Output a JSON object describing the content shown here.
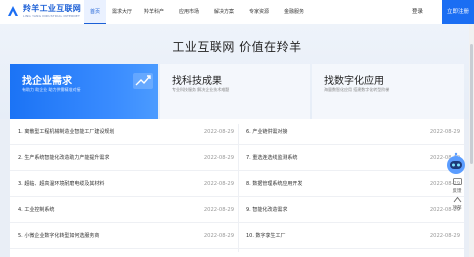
{
  "logo": {
    "title": "羚羊工业互联网",
    "subtitle": "LING YANG INDUSTRIAL INTERNET",
    "icon": "antelope-logo-icon"
  },
  "nav": {
    "items": [
      {
        "label": "首页",
        "active": true
      },
      {
        "label": "需求大厅",
        "active": false
      },
      {
        "label": "羚羊科产",
        "active": false
      },
      {
        "label": "应用市场",
        "active": false
      },
      {
        "label": "解决方案",
        "active": false
      },
      {
        "label": "专家资源",
        "active": false
      },
      {
        "label": "金融服务",
        "active": false
      }
    ],
    "login": "登录",
    "register": "立即注册"
  },
  "hero": {
    "title": "工业互联网 价值在羚羊",
    "cards": [
      {
        "title": "找企业需求",
        "subtitle": "有助力 助企业 助力供需精准对接",
        "icon": "growth-chart-icon"
      },
      {
        "title": "找科技成果",
        "subtitle": "专业科技服务 解决企业技术难题",
        "icon": "lightbulb-icon"
      },
      {
        "title": "找数字化应用",
        "subtitle": "海量数智化应用 搭建数字化转型阶梯",
        "icon": "app-grid-icon"
      }
    ]
  },
  "list": {
    "left": [
      {
        "title": "1. 离散型工程机械制造业智能工厂建设规划",
        "date": "2022-08-29"
      },
      {
        "title": "2. 生产系统智能化改造助力产能提升需求",
        "date": "2022-08-29"
      },
      {
        "title": "3. 超临、超高温环境耐磨电缆及其材料",
        "date": "2022-08-29"
      },
      {
        "title": "4. 工业控制系统",
        "date": "2022-08-29"
      },
      {
        "title": "5. 小微企业数字化转型如何选服务商",
        "date": "2022-08-29"
      }
    ],
    "right": [
      {
        "title": "6. 产业链供需对接",
        "date": "2022-08-29"
      },
      {
        "title": "7. 重选连选线监测系统",
        "date": "2022-08-29"
      },
      {
        "title": "8. 数据管理系统应用开发",
        "date": "2022-08-29"
      },
      {
        "title": "9. 智能化改造需求",
        "date": "2022-08-29"
      },
      {
        "title": "10. 数字孪生工厂",
        "date": "2022-08-29"
      }
    ]
  },
  "side": {
    "feedback": "反馈",
    "top": "顶部",
    "robot_icon": "robot-assistant-icon"
  },
  "colors": {
    "brand": "#1b6ef3",
    "card_active": "#1b73f5",
    "text_date": "#999999"
  }
}
